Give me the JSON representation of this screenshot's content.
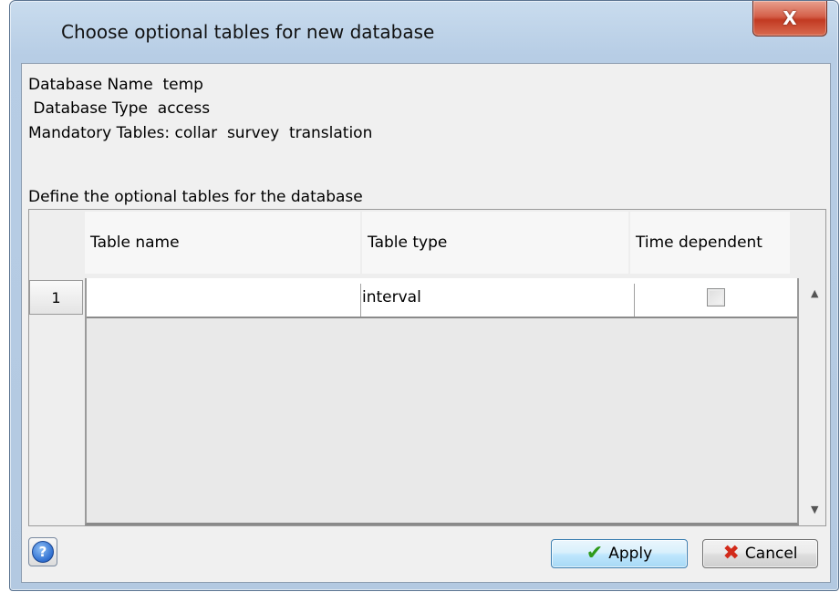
{
  "window": {
    "title": "Choose optional tables for new database",
    "close_label": "X"
  },
  "info": {
    "database_name_line": "Database Name  temp",
    "database_type_line": " Database Type  access",
    "mandatory_tables_line": "Mandatory Tables: collar  survey  translation",
    "define_prompt": "Define the optional tables for the database"
  },
  "table": {
    "columns": [
      "Table name",
      "Table type",
      "Time dependent"
    ],
    "rows": [
      {
        "index": "1",
        "table_name": "",
        "table_type": "interval",
        "time_dependent": false
      }
    ]
  },
  "buttons": {
    "help_label": "?",
    "apply_label": "Apply",
    "cancel_label": "Cancel"
  },
  "icons": {
    "help": "help-icon",
    "apply": "checkmark-icon",
    "cancel": "x-icon",
    "close": "close-icon"
  },
  "colors": {
    "close_button": "#c83c23",
    "apply_border": "#3c7fb1"
  }
}
